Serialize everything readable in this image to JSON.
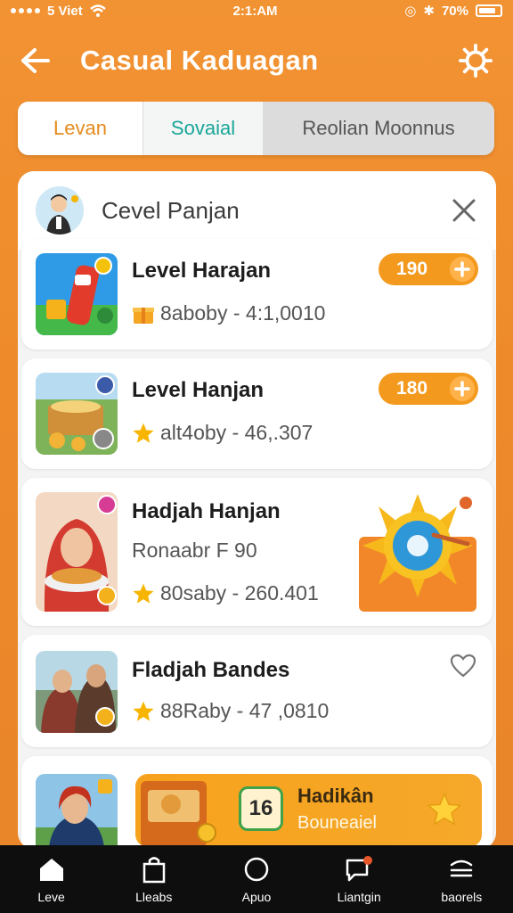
{
  "status_bar": {
    "carrier": "5 Viet",
    "time": "2:1:AM",
    "battery": "70%"
  },
  "header": {
    "title": "Casual Kaduagan"
  },
  "tabs": [
    {
      "label": "Levan"
    },
    {
      "label": "Sovaial"
    },
    {
      "label": "Reolian  Moonnus"
    }
  ],
  "panel": {
    "title": "Cevel Panjan"
  },
  "cards": [
    {
      "title": "Level Harajan",
      "meta": "8aboby - 4:1,0010",
      "price": "190"
    },
    {
      "title": "Level Hanjan",
      "meta": "alt4oby - 46,.307",
      "price": "180"
    },
    {
      "title": "Hadjah Hanjan",
      "line2": "Ronaabr  F 90",
      "meta": "80saby - 260.401"
    },
    {
      "title": "Fladjah Bandes",
      "meta": "88Raby - 47 ,0810"
    },
    {
      "badge": "16",
      "title": "Hadikân",
      "sub": "Bouneaiel"
    }
  ],
  "bottom_nav": [
    {
      "label": "Leve",
      "icon": "home-icon"
    },
    {
      "label": "Lleabs",
      "icon": "bag-icon"
    },
    {
      "label": "Apuo",
      "icon": "circle-icon"
    },
    {
      "label": "Liantgin",
      "icon": "chat-icon"
    },
    {
      "label": "baorels",
      "icon": "stack-icon"
    }
  ],
  "colors": {
    "brand": "#f08a28",
    "accent_teal": "#1aa598",
    "pill": "#f39a1e"
  }
}
